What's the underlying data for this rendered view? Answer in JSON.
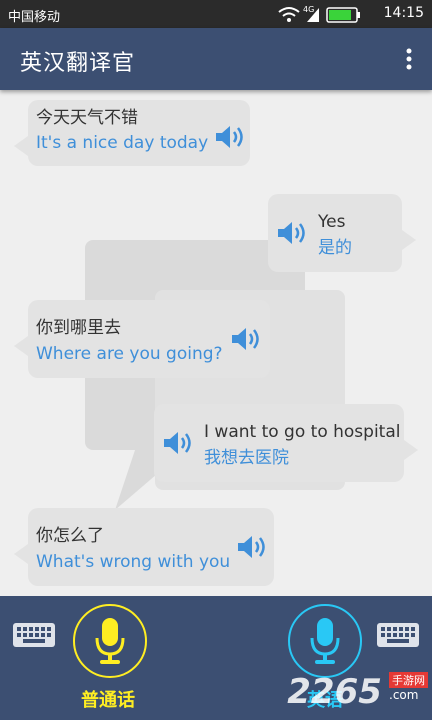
{
  "status_bar": {
    "carrier": "中国移动",
    "network": "4G",
    "time": "14:15"
  },
  "app_bar": {
    "title": "英汉翻译官",
    "menu_icon": "more-vert-icon"
  },
  "messages": [
    {
      "side": "left",
      "source": "今天天气不错",
      "translation": "It's a nice day today"
    },
    {
      "side": "right",
      "source": "Yes",
      "translation": "是的"
    },
    {
      "side": "left",
      "source": "你到哪里去",
      "translation": "Where are you going?"
    },
    {
      "side": "right",
      "source": "I want to go to hospital",
      "translation": "我想去医院"
    },
    {
      "side": "left",
      "source": "你怎么了",
      "translation": "What's wrong with you"
    }
  ],
  "bottom_bar": {
    "left_mic_label": "普通话",
    "right_mic_label": "英语",
    "brand_text": "2265",
    "brand_suffix": ".com",
    "brand_sub": "手游网"
  },
  "colors": {
    "primary": "#3c4f72",
    "mandarin_accent": "#ffee22",
    "english_accent": "#29c8f5",
    "translation_text": "#3f8fd9"
  }
}
